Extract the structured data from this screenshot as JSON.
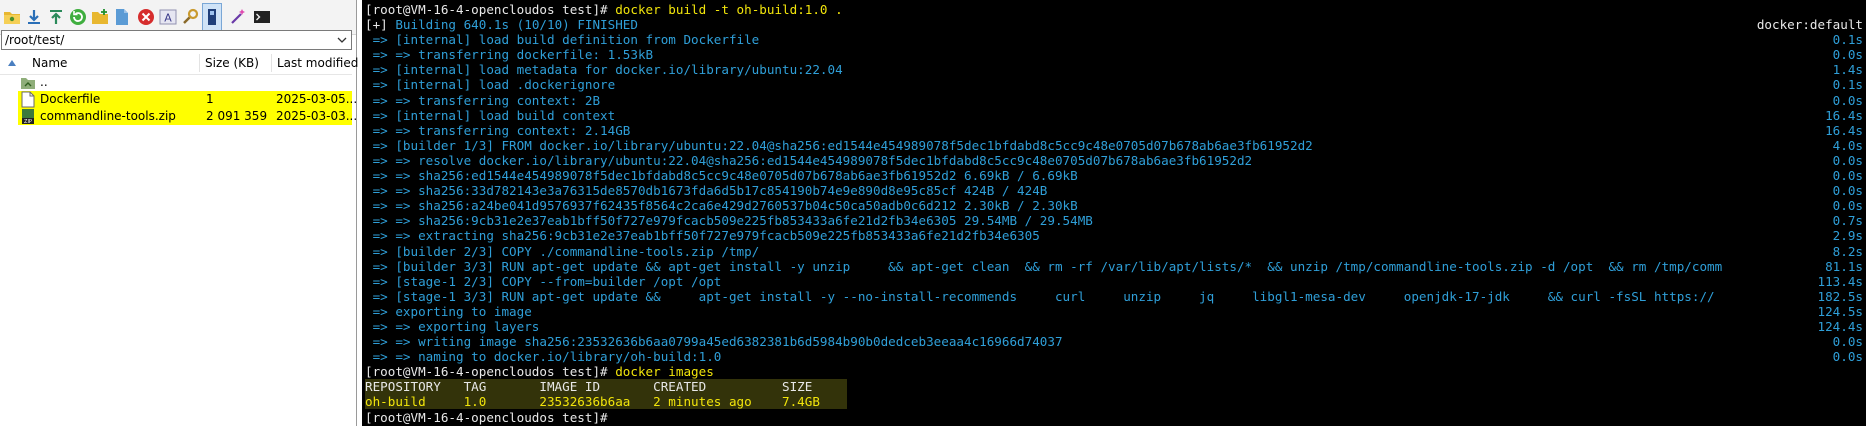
{
  "file_panel": {
    "path": "/root/test/",
    "columns": {
      "name": "Name",
      "size": "Size (KB)",
      "modified": "Last modified"
    },
    "parent_label": "..",
    "files": [
      {
        "name": "Dockerfile",
        "size": "1",
        "modified": "2025-03-05...",
        "selected": true,
        "icon": "file-icon"
      },
      {
        "name": "commandline-tools.zip",
        "size": "2 091 359",
        "modified": "2025-03-03...",
        "selected": true,
        "icon": "zip-file-icon"
      }
    ],
    "toolbar_icons": [
      "open-folder-icon",
      "download-icon",
      "upload-icon",
      "refresh-icon",
      "new-folder-icon",
      "new-file-icon",
      "delete-icon",
      "rename-icon",
      "properties-icon",
      "terminal-toggle-icon",
      "magic-wand-icon",
      "console-icon"
    ]
  },
  "terminal": {
    "lines": [
      {
        "left": "[root@VM-16-4-opencloudos test]# ",
        "cmd": "docker build -t oh-build:1.0 .",
        "right": "",
        "color": "w"
      },
      {
        "left": "[+] ",
        "left2": "Building 640.1s (10/10) FINISHED",
        "right": "docker:default",
        "color": "w",
        "color2": "b"
      },
      {
        "left": " => [internal] load build definition from Dockerfile",
        "right": "0.1s",
        "color": "b"
      },
      {
        "left": " => => transferring dockerfile: 1.53kB",
        "right": "0.0s",
        "color": "b"
      },
      {
        "left": " => [internal] load metadata for docker.io/library/ubuntu:22.04",
        "right": "1.4s",
        "color": "b"
      },
      {
        "left": " => [internal] load .dockerignore",
        "right": "0.1s",
        "color": "b"
      },
      {
        "left": " => => transferring context: 2B",
        "right": "0.0s",
        "color": "b"
      },
      {
        "left": " => [internal] load build context",
        "right": "16.4s",
        "color": "b"
      },
      {
        "left": " => => transferring context: 2.14GB",
        "right": "16.4s",
        "color": "b"
      },
      {
        "left": " => [builder 1/3] FROM docker.io/library/ubuntu:22.04@sha256:ed1544e454989078f5dec1bfdabd8c5cc9c48e0705d07b678ab6ae3fb61952d2",
        "right": "4.0s",
        "color": "b"
      },
      {
        "left": " => => resolve docker.io/library/ubuntu:22.04@sha256:ed1544e454989078f5dec1bfdabd8c5cc9c48e0705d07b678ab6ae3fb61952d2",
        "right": "0.0s",
        "color": "b"
      },
      {
        "left": " => => sha256:ed1544e454989078f5dec1bfdabd8c5cc9c48e0705d07b678ab6ae3fb61952d2 6.69kB / 6.69kB",
        "right": "0.0s",
        "color": "b"
      },
      {
        "left": " => => sha256:33d782143e3a76315de8570db1673fda6d5b17c854190b74e9e890d8e95c85cf 424B / 424B",
        "right": "0.0s",
        "color": "b"
      },
      {
        "left": " => => sha256:a24be041d9576937f62435f8564c2ca6e429d2760537b04c50ca50adb0c6d212 2.30kB / 2.30kB",
        "right": "0.0s",
        "color": "b"
      },
      {
        "left": " => => sha256:9cb31e2e37eab1bff50f727e979fcacb509e225fb853433a6fe21d2fb34e6305 29.54MB / 29.54MB",
        "right": "0.7s",
        "color": "b"
      },
      {
        "left": " => => extracting sha256:9cb31e2e37eab1bff50f727e979fcacb509e225fb853433a6fe21d2fb34e6305",
        "right": "2.9s",
        "color": "b"
      },
      {
        "left": " => [builder 2/3] COPY ./commandline-tools.zip /tmp/",
        "right": "8.2s",
        "color": "b"
      },
      {
        "left": " => [builder 3/3] RUN apt-get update && apt-get install -y unzip     && apt-get clean  && rm -rf /var/lib/apt/lists/*  && unzip /tmp/commandline-tools.zip -d /opt  && rm /tmp/comm",
        "right": "81.1s",
        "color": "b"
      },
      {
        "left": " => [stage-1 2/3] COPY --from=builder /opt /opt",
        "right": "113.4s",
        "color": "b"
      },
      {
        "left": " => [stage-1 3/3] RUN apt-get update &&     apt-get install -y --no-install-recommends     curl     unzip     jq     libgl1-mesa-dev     openjdk-17-jdk     && curl -fsSL https://",
        "right": "182.5s",
        "color": "b"
      },
      {
        "left": " => exporting to image",
        "right": "124.5s",
        "color": "b"
      },
      {
        "left": " => => exporting layers",
        "right": "124.4s",
        "color": "b"
      },
      {
        "left": " => => writing image sha256:23532636b6aa0799a45ed6382381b6d5984b90b0dedceb3eeaa4c16966d74037",
        "right": "0.0s",
        "color": "b"
      },
      {
        "left": " => => naming to docker.io/library/oh-build:1.0",
        "right": "0.0s",
        "color": "b"
      },
      {
        "left": "[root@VM-16-4-opencloudos test]# ",
        "cmd": "docker images",
        "right": "",
        "color": "w"
      },
      {
        "left": "REPOSITORY   TAG       IMAGE ID       CREATED          SIZE",
        "right": "",
        "color": "w",
        "highlight": true
      },
      {
        "left": "oh-build     1.0       23532636b6aa   2 minutes ago    7.4GB",
        "right": "",
        "color": "y",
        "highlight": true
      },
      {
        "left": "[root@VM-16-4-opencloudos test]# ",
        "right": "",
        "color": "w"
      }
    ]
  },
  "colors": {
    "terminal_bg": "#000000",
    "prompt": "#e8e8e8",
    "command": "#f2e50b",
    "build_output": "#2f9fd8",
    "selection": "#ffff00"
  }
}
